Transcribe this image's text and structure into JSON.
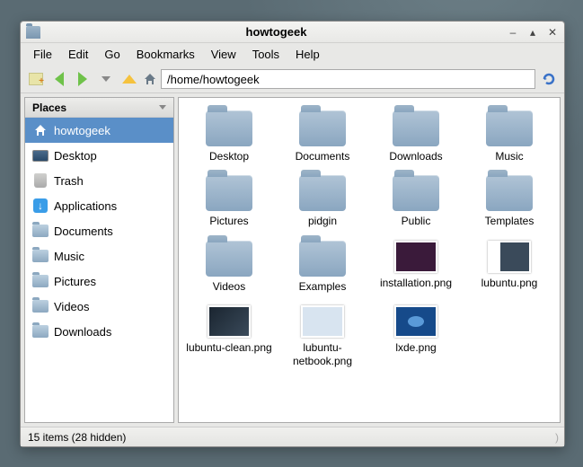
{
  "window": {
    "title": "howtogeek"
  },
  "menubar": [
    "File",
    "Edit",
    "Go",
    "Bookmarks",
    "View",
    "Tools",
    "Help"
  ],
  "path": "/home/howtogeek",
  "sidebar": {
    "header": "Places",
    "items": [
      {
        "label": "howtogeek",
        "icon": "home",
        "selected": true
      },
      {
        "label": "Desktop",
        "icon": "desktop",
        "selected": false
      },
      {
        "label": "Trash",
        "icon": "trash",
        "selected": false
      },
      {
        "label": "Applications",
        "icon": "app",
        "selected": false
      },
      {
        "label": "Documents",
        "icon": "folder",
        "selected": false
      },
      {
        "label": "Music",
        "icon": "folder",
        "selected": false
      },
      {
        "label": "Pictures",
        "icon": "folder",
        "selected": false
      },
      {
        "label": "Videos",
        "icon": "folder",
        "selected": false
      },
      {
        "label": "Downloads",
        "icon": "folder",
        "selected": false
      }
    ]
  },
  "files": [
    {
      "name": "Desktop",
      "type": "folder"
    },
    {
      "name": "Documents",
      "type": "folder"
    },
    {
      "name": "Downloads",
      "type": "folder"
    },
    {
      "name": "Music",
      "type": "folder"
    },
    {
      "name": "Pictures",
      "type": "folder"
    },
    {
      "name": "pidgin",
      "type": "folder"
    },
    {
      "name": "Public",
      "type": "folder"
    },
    {
      "name": "Templates",
      "type": "folder"
    },
    {
      "name": "Videos",
      "type": "folder"
    },
    {
      "name": "Examples",
      "type": "folder"
    },
    {
      "name": "installation.png",
      "type": "image",
      "thumb": "purple"
    },
    {
      "name": "lubuntu.png",
      "type": "image",
      "thumb": "white-border"
    },
    {
      "name": "lubuntu-clean.png",
      "type": "image",
      "thumb": "dark"
    },
    {
      "name": "lubuntu-netbook.png",
      "type": "image",
      "thumb": "light"
    },
    {
      "name": "lxde.png",
      "type": "image",
      "thumb": "blue"
    }
  ],
  "status": "15 items (28 hidden)"
}
